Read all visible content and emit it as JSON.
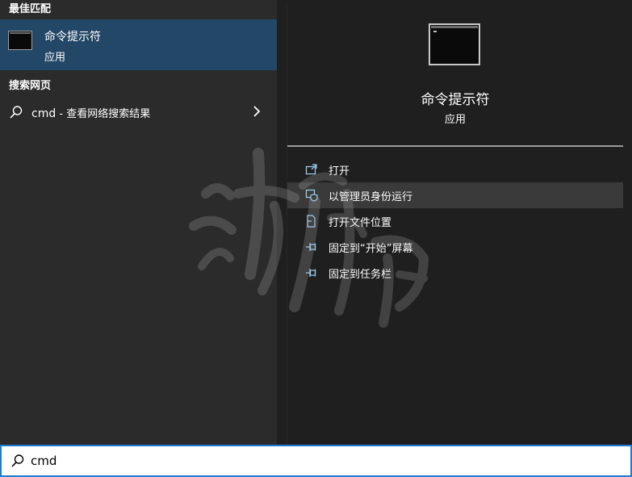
{
  "left": {
    "best_match_header": "最佳匹配",
    "best_match": {
      "title": "命令提示符",
      "subtitle": "应用",
      "icon": "command-prompt-icon"
    },
    "web_header": "搜索网页",
    "web_item": {
      "query": "cmd",
      "suffix": " - 查看网络搜索结果",
      "icon": "search-icon"
    }
  },
  "detail": {
    "title": "命令提示符",
    "subtitle": "应用",
    "actions": [
      {
        "label": "打开",
        "icon": "open-icon"
      },
      {
        "label": "以管理员身份运行",
        "icon": "shield-icon"
      },
      {
        "label": "打开文件位置",
        "icon": "file-location-icon"
      },
      {
        "label": "固定到“开始”屏幕",
        "icon": "pin-icon"
      },
      {
        "label": "固定到任务栏",
        "icon": "pin-icon"
      }
    ]
  },
  "search": {
    "value": "cmd"
  },
  "colors": {
    "selected": "#234766",
    "accent": "#1f7ad2",
    "hover": "#3a3a3a"
  }
}
